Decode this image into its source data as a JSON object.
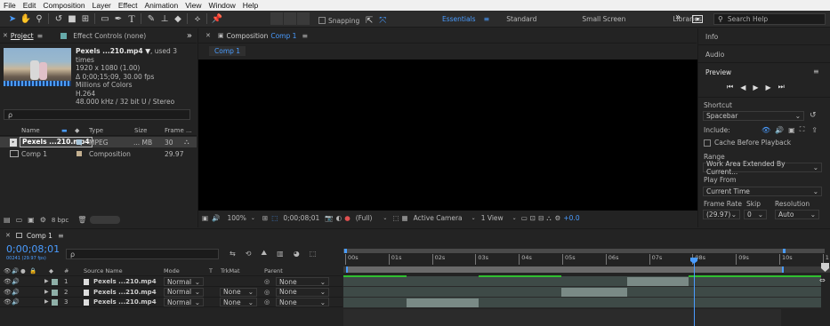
{
  "menu": [
    "File",
    "Edit",
    "Composition",
    "Layer",
    "Effect",
    "Animation",
    "View",
    "Window",
    "Help"
  ],
  "toolbar": {
    "snapping_label": "Snapping",
    "workspaces": [
      "Essentials",
      "Standard",
      "Small Screen",
      "Libraries"
    ],
    "active_workspace": "Essentials",
    "search_placeholder": "Search Help",
    "more": "»"
  },
  "project_panel": {
    "tab_project": "Project",
    "tab_effect_controls": "Effect Controls (none)",
    "more": "»",
    "footage": {
      "name": "Pexels ...210.mp4 ▼",
      "used": ", used 3 times",
      "resolution": "1920 x 1080 (1.00)",
      "duration": "Δ 0;00;15;09, 30.00 fps",
      "colors": "Millions of Colors",
      "codec": "H.264",
      "audio": "48.000 kHz / 32 bit U / Stereo"
    },
    "search_icon": "ρ",
    "columns": [
      "Name",
      "Type",
      "Size",
      "Frame ..."
    ],
    "items": [
      {
        "name": "Pexels ...210.mp4",
        "type": "MPEG",
        "size": "... MB",
        "frame": "30",
        "selected": true
      },
      {
        "name": "Comp 1",
        "type": "Composition",
        "size": "",
        "frame": "29.97",
        "selected": false
      }
    ],
    "bpc": "8 bpc"
  },
  "comp_viewer": {
    "tab": "Composition",
    "tab_comp": "Comp 1",
    "tab_menu": "≡",
    "breadcrumb": "Comp 1",
    "zoom": "100%",
    "timecode": "0;00;08;01",
    "resolution": "(Full)",
    "camera": "Active Camera",
    "view": "1 View",
    "exposure": "+0.0"
  },
  "right_panel": {
    "info": "Info",
    "audio": "Audio",
    "preview": "Preview",
    "shortcut_label": "Shortcut",
    "shortcut_value": "Spacebar",
    "include_label": "Include:",
    "cache_label": "Cache Before Playback",
    "range_label": "Range",
    "range_value": "Work Area Extended By Current...",
    "playfrom_label": "Play From",
    "playfrom_value": "Current Time",
    "framerate_label": "Frame Rate",
    "skip_label": "Skip",
    "resolution_label": "Resolution",
    "framerate_value": "(29.97)",
    "skip_value": "0",
    "resolution_value": "Auto"
  },
  "timeline": {
    "tab": "Comp 1",
    "timecode": "0;00;08;01",
    "timecode_sub": "00241 (29.97 fps)",
    "search_icon": "ρ",
    "columns": {
      "num": "#",
      "source": "Source Name",
      "mode": "Mode",
      "t": "T",
      "trkmat": "TrkMat",
      "parent": "Parent"
    },
    "ticks": [
      "00s",
      "01s",
      "02s",
      "03s",
      "04s",
      "05s",
      "06s",
      "07s",
      "08s",
      "09s",
      "10s",
      "1"
    ],
    "layers": [
      {
        "num": "1",
        "name": "Pexels ...210.mp4",
        "mode": "Normal",
        "trkmat": "",
        "parent": "None"
      },
      {
        "num": "2",
        "name": "Pexels ...210.mp4",
        "mode": "Normal",
        "trkmat": "None",
        "parent": "None"
      },
      {
        "num": "3",
        "name": "Pexels ...210.mp4",
        "mode": "Normal",
        "trkmat": "None",
        "parent": "None"
      }
    ]
  },
  "colors": {
    "accent": "#4a9cff",
    "layer_label": "#8fb0a8",
    "green_bar": "#30c030"
  }
}
